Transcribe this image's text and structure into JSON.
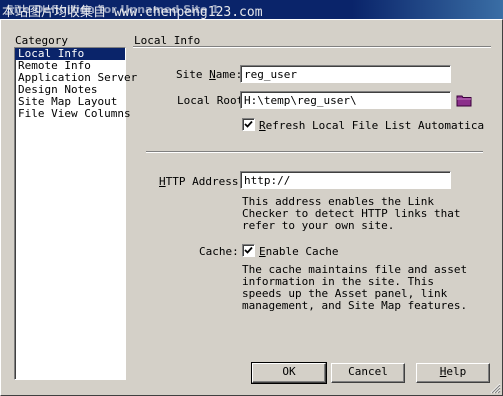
{
  "window": {
    "title": "Site Definition for Unnamed Site 1",
    "watermark": "本站图片均收集自 www.chenpeng123.com"
  },
  "category": {
    "label": "Category",
    "items": [
      {
        "label": "Local Info",
        "selected": true
      },
      {
        "label": "Remote Info",
        "selected": false
      },
      {
        "label": "Application Server",
        "selected": false
      },
      {
        "label": "Design Notes",
        "selected": false
      },
      {
        "label": "Site Map Layout",
        "selected": false
      },
      {
        "label": "File View Columns",
        "selected": false
      }
    ]
  },
  "panel": {
    "title": "Local Info",
    "site_name": {
      "label_pre": "Site ",
      "label_key": "N",
      "label_post": "ame:",
      "value": "reg_user"
    },
    "local_root": {
      "label": "Local Root",
      "value": "H:\\temp\\reg_user\\"
    },
    "refresh": {
      "checked": true,
      "label_key": "R",
      "label_rest": "efresh Local File List Automatica"
    },
    "http_address": {
      "label_key": "H",
      "label_rest": "TTP Address:",
      "value": "http://"
    },
    "http_help": "This address enables the Link\nChecker to detect HTTP links that\nrefer to your own site.",
    "cache": {
      "label": "Cache:",
      "checked": true,
      "label_key": "E",
      "label_rest": "nable Cache"
    },
    "cache_help": "The cache maintains file and asset\ninformation in the site.  This\nspeeds up the Asset panel, link\nmanagement, and Site Map features."
  },
  "buttons": {
    "ok": "OK",
    "cancel": "Cancel",
    "help_key": "H",
    "help_rest": "elp"
  },
  "colors": {
    "titlebar": "#0a246a",
    "face": "#d4d0c8",
    "selection": "#0a246a",
    "folder": "#8b2f8b"
  }
}
